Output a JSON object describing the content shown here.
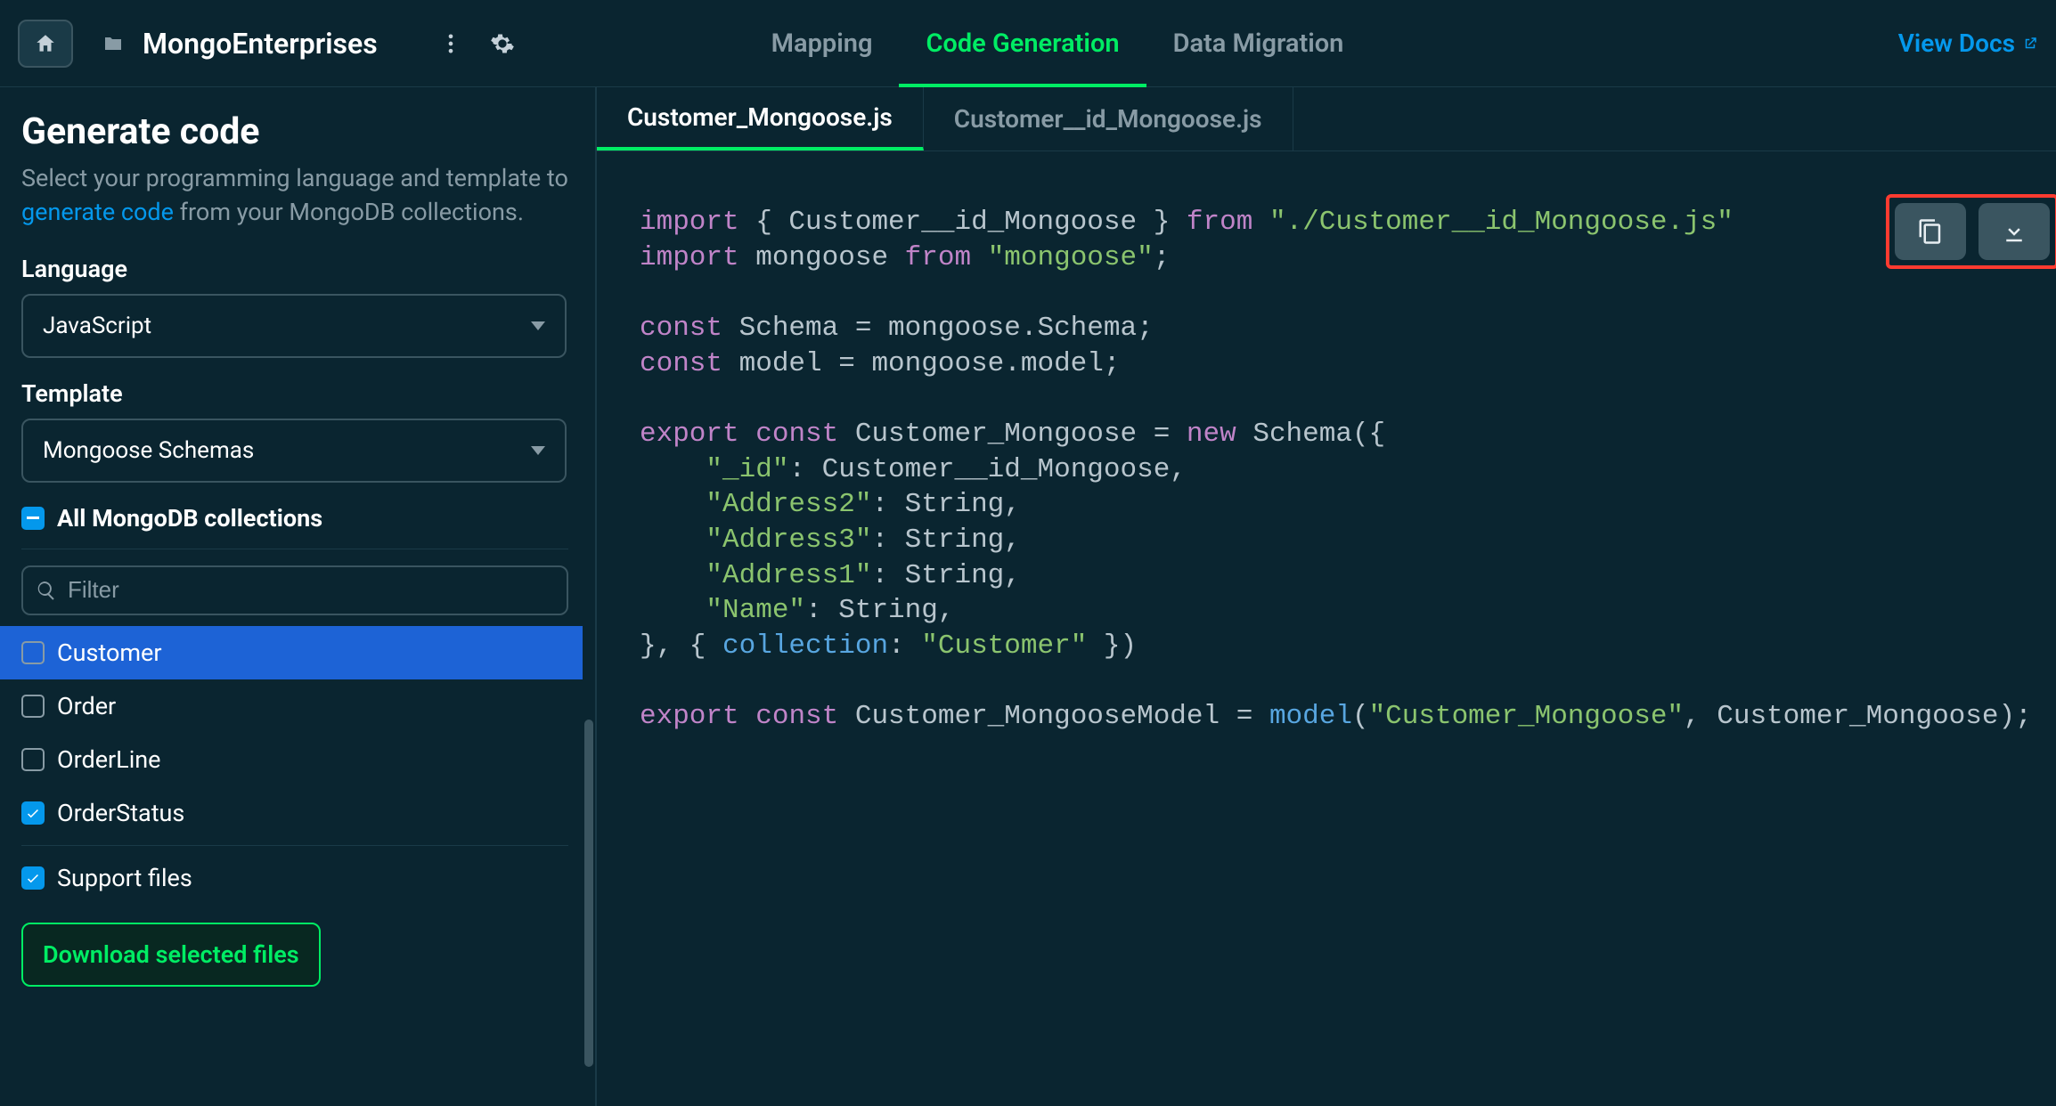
{
  "header": {
    "project_name": "MongoEnterprises",
    "nav_tabs": {
      "mapping": "Mapping",
      "code_generation": "Code Generation",
      "data_migration": "Data Migration"
    },
    "view_docs": "View Docs"
  },
  "sidebar": {
    "title": "Generate code",
    "description_prefix": "Select your programming language and template to ",
    "description_link": "generate code",
    "description_suffix": " from your MongoDB collections.",
    "language_label": "Language",
    "language_value": "JavaScript",
    "template_label": "Template",
    "template_value": "Mongoose Schemas",
    "all_collections_label": "All MongoDB collections",
    "filter_placeholder": "Filter",
    "collections": [
      {
        "name": "Customer",
        "checked": false,
        "selected": true
      },
      {
        "name": "Order",
        "checked": false,
        "selected": false
      },
      {
        "name": "OrderLine",
        "checked": false,
        "selected": false
      },
      {
        "name": "OrderStatus",
        "checked": true,
        "selected": false
      }
    ],
    "support_files_label": "Support files",
    "download_btn": "Download selected files"
  },
  "editor": {
    "tabs": [
      {
        "name": "Customer_Mongoose.js",
        "active": true
      },
      {
        "name": "Customer__id_Mongoose.js",
        "active": false
      }
    ],
    "code_tokens": [
      [
        {
          "t": "kw",
          "v": "import"
        },
        {
          "t": "plain",
          "v": " { Customer__id_Mongoose } "
        },
        {
          "t": "kw",
          "v": "from"
        },
        {
          "t": "plain",
          "v": " "
        },
        {
          "t": "str",
          "v": "\"./Customer__id_Mongoose.js\""
        }
      ],
      [
        {
          "t": "kw",
          "v": "import"
        },
        {
          "t": "plain",
          "v": " mongoose "
        },
        {
          "t": "kw",
          "v": "from"
        },
        {
          "t": "plain",
          "v": " "
        },
        {
          "t": "str",
          "v": "\"mongoose\""
        },
        {
          "t": "plain",
          "v": ";"
        }
      ],
      [],
      [
        {
          "t": "kw",
          "v": "const"
        },
        {
          "t": "plain",
          "v": " Schema = mongoose.Schema;"
        }
      ],
      [
        {
          "t": "kw",
          "v": "const"
        },
        {
          "t": "plain",
          "v": " model = mongoose.model;"
        }
      ],
      [],
      [
        {
          "t": "kw",
          "v": "export"
        },
        {
          "t": "plain",
          "v": " "
        },
        {
          "t": "kw",
          "v": "const"
        },
        {
          "t": "plain",
          "v": " Customer_Mongoose = "
        },
        {
          "t": "kw",
          "v": "new"
        },
        {
          "t": "plain",
          "v": " Schema({"
        }
      ],
      [
        {
          "t": "plain",
          "v": "    "
        },
        {
          "t": "str",
          "v": "\"_id\""
        },
        {
          "t": "plain",
          "v": ": Customer__id_Mongoose,"
        }
      ],
      [
        {
          "t": "plain",
          "v": "    "
        },
        {
          "t": "str",
          "v": "\"Address2\""
        },
        {
          "t": "plain",
          "v": ": String,"
        }
      ],
      [
        {
          "t": "plain",
          "v": "    "
        },
        {
          "t": "str",
          "v": "\"Address3\""
        },
        {
          "t": "plain",
          "v": ": String,"
        }
      ],
      [
        {
          "t": "plain",
          "v": "    "
        },
        {
          "t": "str",
          "v": "\"Address1\""
        },
        {
          "t": "plain",
          "v": ": String,"
        }
      ],
      [
        {
          "t": "plain",
          "v": "    "
        },
        {
          "t": "str",
          "v": "\"Name\""
        },
        {
          "t": "plain",
          "v": ": String,"
        }
      ],
      [
        {
          "t": "plain",
          "v": "}, { "
        },
        {
          "t": "fn",
          "v": "collection"
        },
        {
          "t": "plain",
          "v": ": "
        },
        {
          "t": "str",
          "v": "\"Customer\""
        },
        {
          "t": "plain",
          "v": " })"
        }
      ],
      [],
      [
        {
          "t": "kw",
          "v": "export"
        },
        {
          "t": "plain",
          "v": " "
        },
        {
          "t": "kw",
          "v": "const"
        },
        {
          "t": "plain",
          "v": " Customer_MongooseModel = "
        },
        {
          "t": "fn",
          "v": "model"
        },
        {
          "t": "plain",
          "v": "("
        },
        {
          "t": "str",
          "v": "\"Customer_Mongoose\""
        },
        {
          "t": "plain",
          "v": ", Customer_Mongoose);"
        }
      ]
    ]
  },
  "icons": {
    "home": "home-icon",
    "folder": "folder-icon",
    "dots": "dots-vertical-icon",
    "gear": "gear-icon",
    "external": "external-link-icon",
    "search": "search-icon",
    "copy": "copy-icon",
    "download": "download-icon",
    "check": "check-icon"
  },
  "colors": {
    "bg": "#0a2530",
    "accent_green": "#00ed64",
    "accent_blue": "#0498ec",
    "selected_blue": "#1d63d6",
    "highlight_red": "#ff3b30"
  }
}
